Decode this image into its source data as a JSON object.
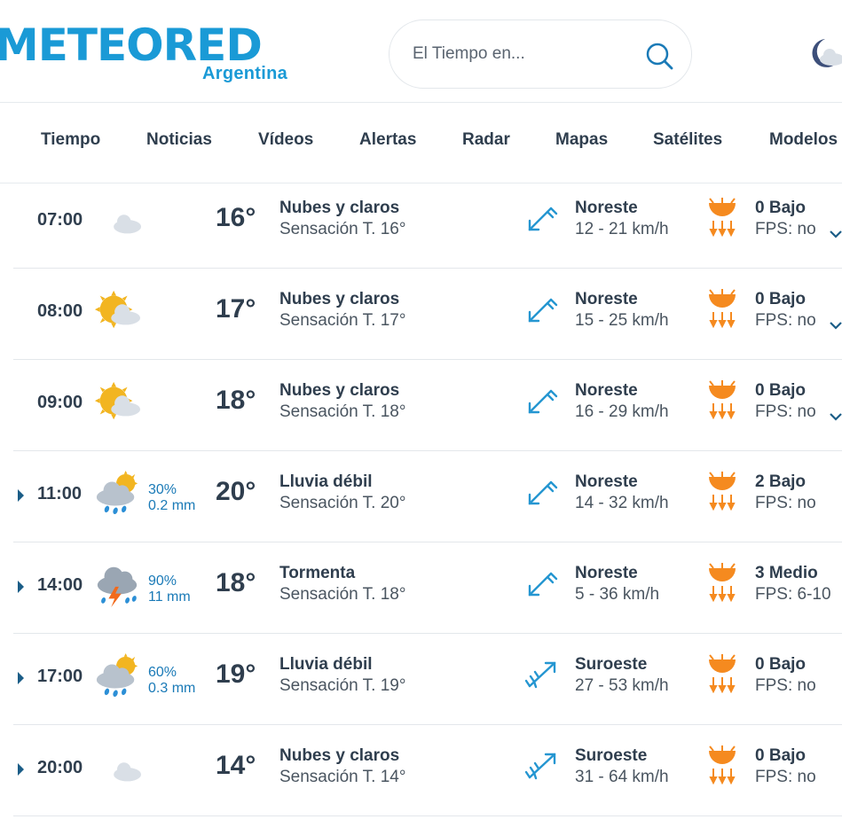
{
  "brand": {
    "logo_text": "METEORED",
    "country": "Argentina",
    "accent": "#1a9ad6"
  },
  "search": {
    "placeholder": "El Tiempo en..."
  },
  "nav": [
    "Tiempo",
    "Noticias",
    "Vídeos",
    "Alertas",
    "Radar",
    "Mapas",
    "Satélites",
    "Modelos"
  ],
  "hours": [
    {
      "expandable": false,
      "time": "07:00",
      "icon": "moon-cloud-icon",
      "precip_prob": "",
      "precip_amount": "",
      "temp": "16°",
      "desc": "Nubes y claros",
      "feel": "Sensación T. 16°",
      "wind_icon": "wind-northeast-icon",
      "wind_dir": "Noreste",
      "wind_speed": "12 - 21 km/h",
      "uv": "0 Bajo",
      "fps": "FPS: no",
      "chevron": true
    },
    {
      "expandable": false,
      "time": "08:00",
      "icon": "sun-cloud-icon",
      "precip_prob": "",
      "precip_amount": "",
      "temp": "17°",
      "desc": "Nubes y claros",
      "feel": "Sensación T. 17°",
      "wind_icon": "wind-northeast-icon",
      "wind_dir": "Noreste",
      "wind_speed": "15 - 25 km/h",
      "uv": "0 Bajo",
      "fps": "FPS: no",
      "chevron": true
    },
    {
      "expandable": false,
      "time": "09:00",
      "icon": "sun-cloud-icon",
      "precip_prob": "",
      "precip_amount": "",
      "temp": "18°",
      "desc": "Nubes y claros",
      "feel": "Sensación T. 18°",
      "wind_icon": "wind-northeast-icon",
      "wind_dir": "Noreste",
      "wind_speed": "16 - 29 km/h",
      "uv": "0 Bajo",
      "fps": "FPS: no",
      "chevron": true
    },
    {
      "expandable": true,
      "time": "11:00",
      "icon": "sun-cloud-rain-icon",
      "precip_prob": "30%",
      "precip_amount": "0.2 mm",
      "temp": "20°",
      "desc": "Lluvia débil",
      "feel": "Sensación T. 20°",
      "wind_icon": "wind-northeast-icon",
      "wind_dir": "Noreste",
      "wind_speed": "14 - 32 km/h",
      "uv": "2 Bajo",
      "fps": "FPS: no",
      "chevron": false
    },
    {
      "expandable": true,
      "time": "14:00",
      "icon": "thunderstorm-icon",
      "precip_prob": "90%",
      "precip_amount": "11 mm",
      "temp": "18°",
      "desc": "Tormenta",
      "feel": "Sensación T. 18°",
      "wind_icon": "wind-northeast-icon",
      "wind_dir": "Noreste",
      "wind_speed": "5 - 36 km/h",
      "uv": "3 Medio",
      "fps": "FPS: 6-10",
      "chevron": false
    },
    {
      "expandable": true,
      "time": "17:00",
      "icon": "sun-cloud-rain-icon",
      "precip_prob": "60%",
      "precip_amount": "0.3 mm",
      "temp": "19°",
      "desc": "Lluvia débil",
      "feel": "Sensación T. 19°",
      "wind_icon": "wind-southwest-icon",
      "wind_dir": "Suroeste",
      "wind_speed": "27 - 53 km/h",
      "uv": "0 Bajo",
      "fps": "FPS: no",
      "chevron": false
    },
    {
      "expandable": true,
      "time": "20:00",
      "icon": "moon-cloud-icon",
      "precip_prob": "",
      "precip_amount": "",
      "temp": "14°",
      "desc": "Nubes y claros",
      "feel": "Sensación T. 14°",
      "wind_icon": "wind-southwest-icon",
      "wind_dir": "Suroeste",
      "wind_speed": "31 - 64 km/h",
      "uv": "0 Bajo",
      "fps": "FPS: no",
      "chevron": false
    }
  ]
}
